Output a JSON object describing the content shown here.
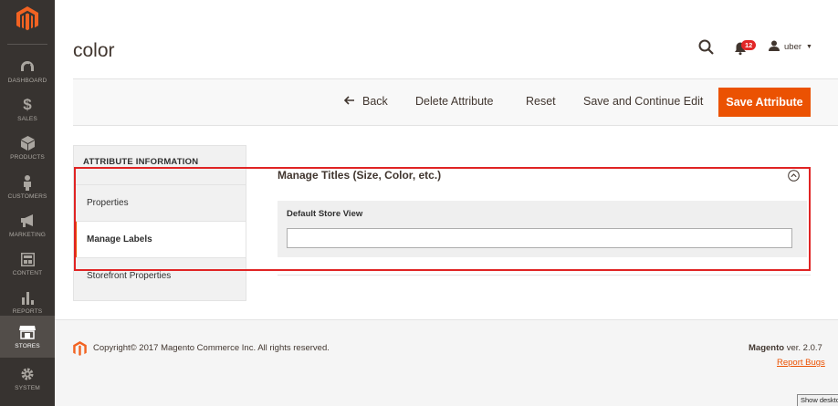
{
  "sidebar": {
    "items": [
      {
        "label": "DASHBOARD",
        "icon": "dashboard-icon"
      },
      {
        "label": "SALES",
        "icon": "dollar-icon"
      },
      {
        "label": "PRODUCTS",
        "icon": "cube-icon"
      },
      {
        "label": "CUSTOMERS",
        "icon": "person-icon"
      },
      {
        "label": "MARKETING",
        "icon": "megaphone-icon"
      },
      {
        "label": "CONTENT",
        "icon": "layout-icon"
      },
      {
        "label": "REPORTS",
        "icon": "bar-chart-icon"
      },
      {
        "label": "STORES",
        "icon": "store-icon",
        "active": true
      },
      {
        "label": "SYSTEM",
        "icon": "gear-icon"
      }
    ],
    "bg_color": "#373330"
  },
  "header": {
    "title": "color",
    "notification_count": "12",
    "username": "uber"
  },
  "actions": {
    "back": "Back",
    "delete": "Delete Attribute",
    "reset": "Reset",
    "save_continue": "Save and Continue Edit",
    "save": "Save Attribute",
    "accent_color": "#eb5202"
  },
  "tabs": {
    "title": "ATTRIBUTE INFORMATION",
    "items": [
      "Properties",
      "Manage Labels",
      "Storefront Properties"
    ],
    "active": "Manage Labels"
  },
  "main": {
    "section_title": "Manage Titles (Size, Color, etc.)",
    "field_label": "Default Store View",
    "field_value": ""
  },
  "footer": {
    "copyright": "Copyright© 2017 Magento Commerce Inc. All rights reserved.",
    "brand": "Magento",
    "version": "ver. 2.0.7",
    "report_bugs": "Report Bugs"
  },
  "overlay": {
    "show_desktop": "Show deskto"
  }
}
